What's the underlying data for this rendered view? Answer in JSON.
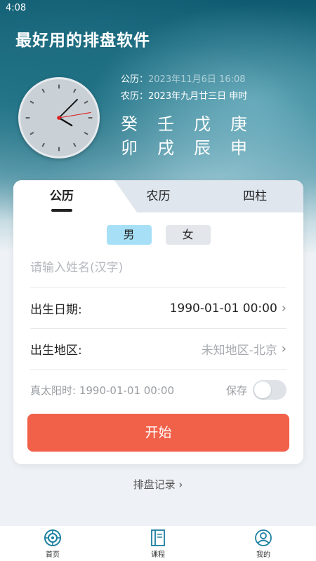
{
  "status": {
    "time": "4:08"
  },
  "app": {
    "title": "最好用的排盘软件"
  },
  "dates": {
    "solar_label": "公历：",
    "solar_value": "2023年11月6日 16:08",
    "lunar_label": "农历：",
    "lunar_value": "2023年九月廿三日 申时"
  },
  "ganzhi": {
    "stems": [
      "癸",
      "壬",
      "戊",
      "庚"
    ],
    "branches": [
      "卯",
      "戌",
      "辰",
      "申"
    ]
  },
  "tabs": [
    {
      "label": "公历"
    },
    {
      "label": "农历"
    },
    {
      "label": "四柱"
    }
  ],
  "gender": {
    "male": "男",
    "female": "女"
  },
  "form": {
    "name_placeholder": "请输入姓名(汉字)",
    "birth_date_label": "出生日期:",
    "birth_date_value": "1990-01-01 00:00",
    "birth_area_label": "出生地区:",
    "birth_area_value": "未知地区-北京",
    "true_solar_label": "真太阳时: 1990-01-01 00:00",
    "save_label": "保存",
    "start_label": "开始"
  },
  "records": {
    "label": "排盘记录 ›"
  },
  "nav": [
    {
      "label": "首页",
      "icon": "home-icon"
    },
    {
      "label": "课程",
      "icon": "book-icon"
    },
    {
      "label": "我的",
      "icon": "profile-icon"
    }
  ],
  "colors": {
    "accent": "#f16049",
    "nav_active": "#1a7fa0",
    "male_selected": "#a7e0f6"
  }
}
